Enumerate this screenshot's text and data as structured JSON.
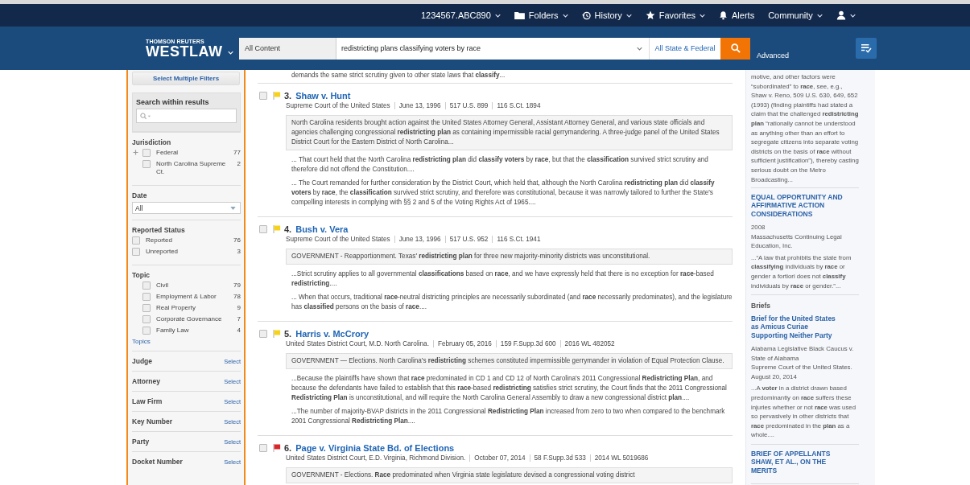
{
  "top_nav": [
    {
      "kind": "account",
      "label": "1234567.ABC890",
      "dropdown": true
    },
    {
      "kind": "folders",
      "label": "Folders",
      "dropdown": true
    },
    {
      "kind": "history",
      "label": "History",
      "dropdown": true
    },
    {
      "kind": "favorites",
      "label": "Favorites",
      "dropdown": true
    },
    {
      "kind": "alerts",
      "label": "Alerts",
      "dropdown": false
    },
    {
      "kind": "community",
      "label": "Community",
      "dropdown": true
    },
    {
      "kind": "user",
      "dropdown": true
    }
  ],
  "brand": {
    "company": "THOMSON REUTERS",
    "product": "WESTLAW"
  },
  "search": {
    "content_type": "All Content",
    "query": "redistricting plans classifying voters by race",
    "jurisdiction": "All State & Federal",
    "advanced": "Advanced"
  },
  "sidebar": {
    "multi_filter_button": "Select Multiple Filters",
    "search_within": "Search within results",
    "facets": [
      {
        "kind": "checklist",
        "title": "Jurisdiction",
        "indented": true,
        "items": [
          {
            "label": "Federal",
            "count": "77",
            "checked": false,
            "expandable": true
          },
          {
            "label": "North Carolina Supreme Ct.",
            "count": "2",
            "checked": false,
            "expandable": false
          }
        ]
      },
      {
        "kind": "dropdown",
        "title": "Date",
        "value": "All"
      },
      {
        "kind": "checklist",
        "title": "Reported Status",
        "indented": false,
        "items": [
          {
            "label": "Reported",
            "count": "76",
            "checked": false,
            "expandable": false
          },
          {
            "label": "Unreported",
            "count": "3",
            "checked": false,
            "expandable": false
          }
        ]
      },
      {
        "kind": "checklist",
        "title": "Topic",
        "indented": true,
        "link": "Topics",
        "items": [
          {
            "label": "Civil",
            "count": "79",
            "checked": false,
            "expandable": false
          },
          {
            "label": "Employment & Labor",
            "count": "78",
            "checked": false,
            "expandable": false
          },
          {
            "label": "Real Property",
            "count": "9",
            "checked": false,
            "expandable": false
          },
          {
            "label": "Corporate Governance",
            "count": "7",
            "checked": false,
            "expandable": false
          },
          {
            "label": "Family Law",
            "count": "4",
            "checked": false,
            "expandable": false
          }
        ]
      },
      {
        "kind": "select",
        "title": "Judge",
        "action": "Select"
      },
      {
        "kind": "select",
        "title": "Attorney",
        "action": "Select"
      },
      {
        "kind": "select",
        "title": "Law Firm",
        "action": "Select"
      },
      {
        "kind": "select",
        "title": "Key Number",
        "action": "Select"
      },
      {
        "kind": "select",
        "title": "Party",
        "action": "Select"
      },
      {
        "kind": "select",
        "title": "Docket Number",
        "action": "Select"
      }
    ]
  },
  "results": {
    "prior_snippet": "demands the same strict scrutiny given to other state laws that **classify**...",
    "items": [
      {
        "number": "3.",
        "title": "Shaw v. Hunt",
        "checked": false,
        "color": "#f6d21a",
        "meta": [
          "Supreme Court of the United States",
          "June 13, 1996",
          "517 U.S. 899",
          "116 S.Ct. 1894"
        ],
        "summary": "North Carolina residents brought action against the United States Attorney General, Assistant Attorney General, and various state officials and agencies challenging congressional **redistricting** **plan** as containing impermissible racial gerrymandering. A three-judge panel of the United States District Court for the Eastern District of North Carolina...",
        "snippets": [
          "...   That court held that the North Carolina **redistricting** **plan** did **classify**  **voters** by **race**, but that the **classification** survived strict scrutiny and therefore did not offend the Constitution....",
          "...   The Court remanded for further consideration by the District Court, which held that, although the North Carolina **redistricting** **plan** did **classify** **voters** by **race**, the **classification** survived strict scrutiny, and therefore was constitutional, because it was narrowly tailored to further the State's compelling interests in complying with §§  2 and 5 of the Voting Rights Act of 1965...."
        ]
      },
      {
        "number": "4.",
        "title": "Bush v. Vera",
        "checked": false,
        "color": "#f6d21a",
        "meta": [
          "Supreme Court of the United States",
          "June 13, 1996",
          "517 U.S. 952",
          "116 S.Ct. 1941"
        ],
        "summary": "GOVERNMENT - Reapportionment. Texas' **redistricting** **plan** for three new majority-minority districts was unconstitutional.",
        "snippets": [
          "...Strict scrutiny applies to all governmental **classifications** based on **race**, and we have expressly held that there is no exception for **race**-based **redistricting**....",
          "...   When that occurs, traditional **race**-neutral districting principles are necessarily subordinated (and **race** necessarily predominates), and the legislature has **classified** persons on the basis of **race**...."
        ]
      },
      {
        "number": "5.",
        "title": "Harris v. McCrory",
        "checked": false,
        "color": "#f6d21a",
        "meta": [
          "United States District Court, M.D. North Carolina.",
          "February 05, 2016",
          "159 F.Supp.3d 600",
          "2016 WL 482052"
        ],
        "summary": "GOVERNMENT — Elections. North Carolina's **redistricting** schemes constituted impermissible gerrymander in violation of Equal Protection Clause.",
        "snippets": [
          "...Because the plaintiffs have shown that **race** predominated in CD 1 and CD 12 of North Carolina's 2011 Congressional **Redistricting** **Plan**, and because the defendants have failed to establish that this **race**-based **redistricting** satisfies strict scrutiny, the Court finds that the 2011 Congressional **Redistricting** **Plan** is unconstitutional, and will require the North Carolina General Assembly to draw a new congressional district **plan**....",
          "...The number of majority-BVAP districts in the 2011 Congressional **Redistricting** **Plan** increased from zero to two when compared to the benchmark 2001 Congressional **Redistricting** **Plan**...."
        ]
      },
      {
        "number": "6.",
        "title": "Page v. Virginia State Bd. of Elections",
        "checked": false,
        "color": "#d8262b",
        "meta": [
          "United States District Court, E.D. Virginia, Richmond Division.",
          "October 07, 2014",
          "58 F.Supp.3d 533",
          "2014 WL 5019686"
        ],
        "summary": "GOVERNMENT - Elections. **Race** predominated when Virginia state legislature devised a congressional voting district"
      }
    ]
  },
  "related": {
    "prior_snippet": "motive, and other factors were “subordinated” to **race**, see, e.g., Shaw v. Reno, 509 U.S. 630, 649, 652 (1993) (finding plaintiffs had stated a claim that the challenged **redistricting** **plan** “rationally cannot be understood as anything other than an effort to segregate citizens into separate voting districts on the basis of **race** without sufficient justification”), thereby casting serious doubt on the Metro Broadcasting...",
    "items": [
      {
        "kind": "document",
        "title": "EQUAL OPPORTUNITY AND AFFIRMATIVE ACTION CONSIDERATIONS",
        "lines": [
          "2008",
          "Massachusetts Continuing Legal Education, Inc."
        ],
        "snippet": "...“A law that prohibits the state from **classifying** individuals by **race** or gender a fortiori does not **classify** individuals by **race** or gender.”..."
      },
      {
        "kind": "section",
        "title": "Briefs"
      },
      {
        "kind": "document",
        "title": "Brief for the United States as Amicus Curiae Supporting Neither Party",
        "lines": [
          "Alabama Legislative Black Caucus v. State of Alabama",
          "Supreme Court of the United States.",
          "August 20, 2014"
        ],
        "snippet": "...A **voter** in a district drawn based predominantly on **race** suffers these injuries whether or not **race** was used so pervasively in other districts that **race** predominated in the **plan** as a whole...."
      },
      {
        "kind": "document",
        "title": "BRIEF OF APPELLANTS SHAW, ET AL., ON THE MERITS"
      }
    ]
  }
}
